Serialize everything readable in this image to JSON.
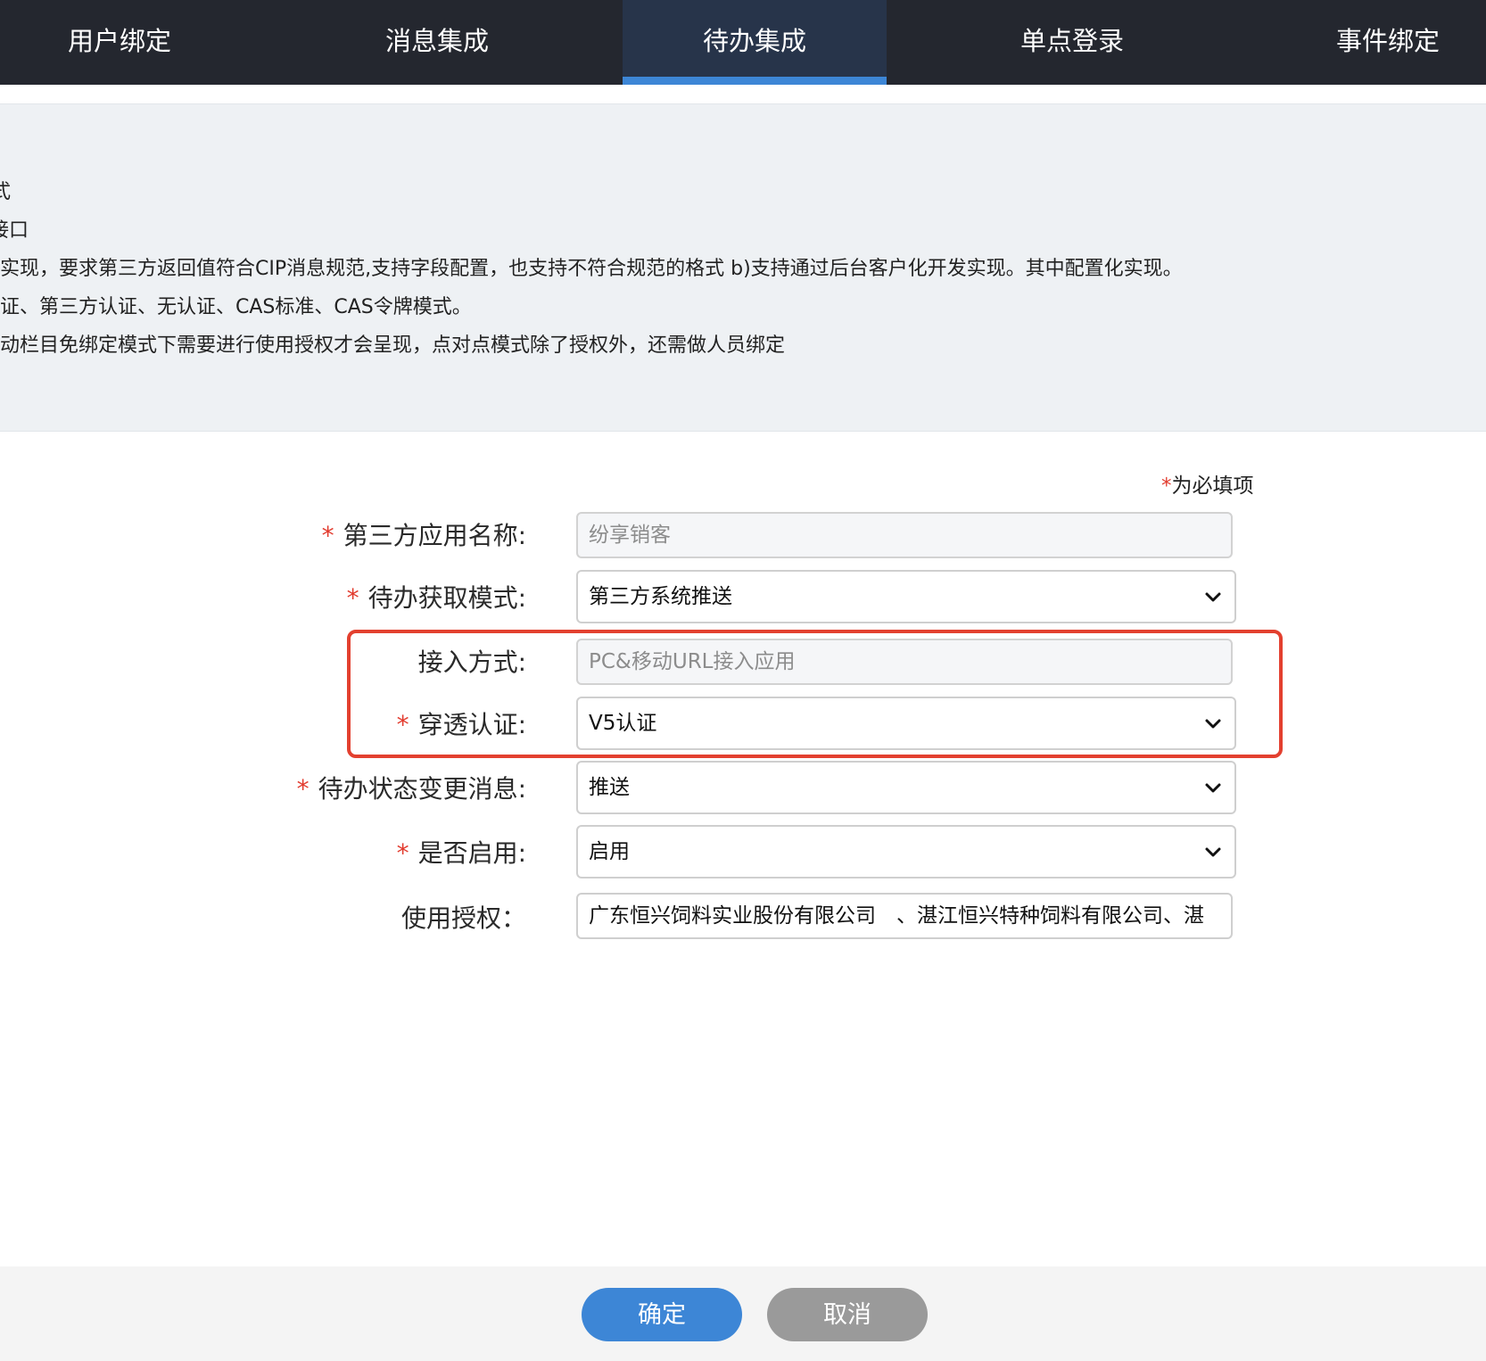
{
  "tabs": [
    {
      "label": "用户绑定"
    },
    {
      "label": "消息集成"
    },
    {
      "label": "待办集成"
    },
    {
      "label": "单点登录"
    },
    {
      "label": "事件绑定"
    }
  ],
  "active_tab": "待办集成",
  "info_lines": [
    "式",
    "接口",
    "实现，要求第三方返回值符合CIP消息规范,支持字段配置，也支持不符合规范的格式 b)支持通过后台客户化开发实现。其中配置化实现。",
    "证、第三方认证、无认证、CAS标准、CAS令牌模式。",
    "动栏目免绑定模式下需要进行使用授权才会呈现，点对点模式除了授权外，还需做人员绑定"
  ],
  "required_note": {
    "star": "*",
    "text": "为必填项"
  },
  "form": {
    "app_name": {
      "label": "第三方应用名称:",
      "required": "*",
      "value": "纷享销客"
    },
    "todo_mode": {
      "label": "待办获取模式:",
      "required": "*",
      "value": "第三方系统推送"
    },
    "access_method": {
      "label": "接入方式:",
      "value": "PC&移动URL接入应用"
    },
    "auth": {
      "label": "穿透认证:",
      "required": "*",
      "value": "V5认证"
    },
    "status_msg": {
      "label": "待办状态变更消息:",
      "required": "*",
      "value": "推送"
    },
    "enabled": {
      "label": "是否启用:",
      "required": "*",
      "value": "启用"
    },
    "authorization": {
      "label": "使用授权：",
      "value": "广东恒兴饲料实业股份有限公司　、湛江恒兴特种饲料有限公司、湛"
    }
  },
  "buttons": {
    "ok": "确定",
    "cancel": "取消"
  },
  "colors": {
    "tabbar": "#24272f",
    "active_tab_bg": "#27344a",
    "accent": "#3d86d6",
    "highlight": "#e3402f",
    "required": "#e23b2e"
  }
}
